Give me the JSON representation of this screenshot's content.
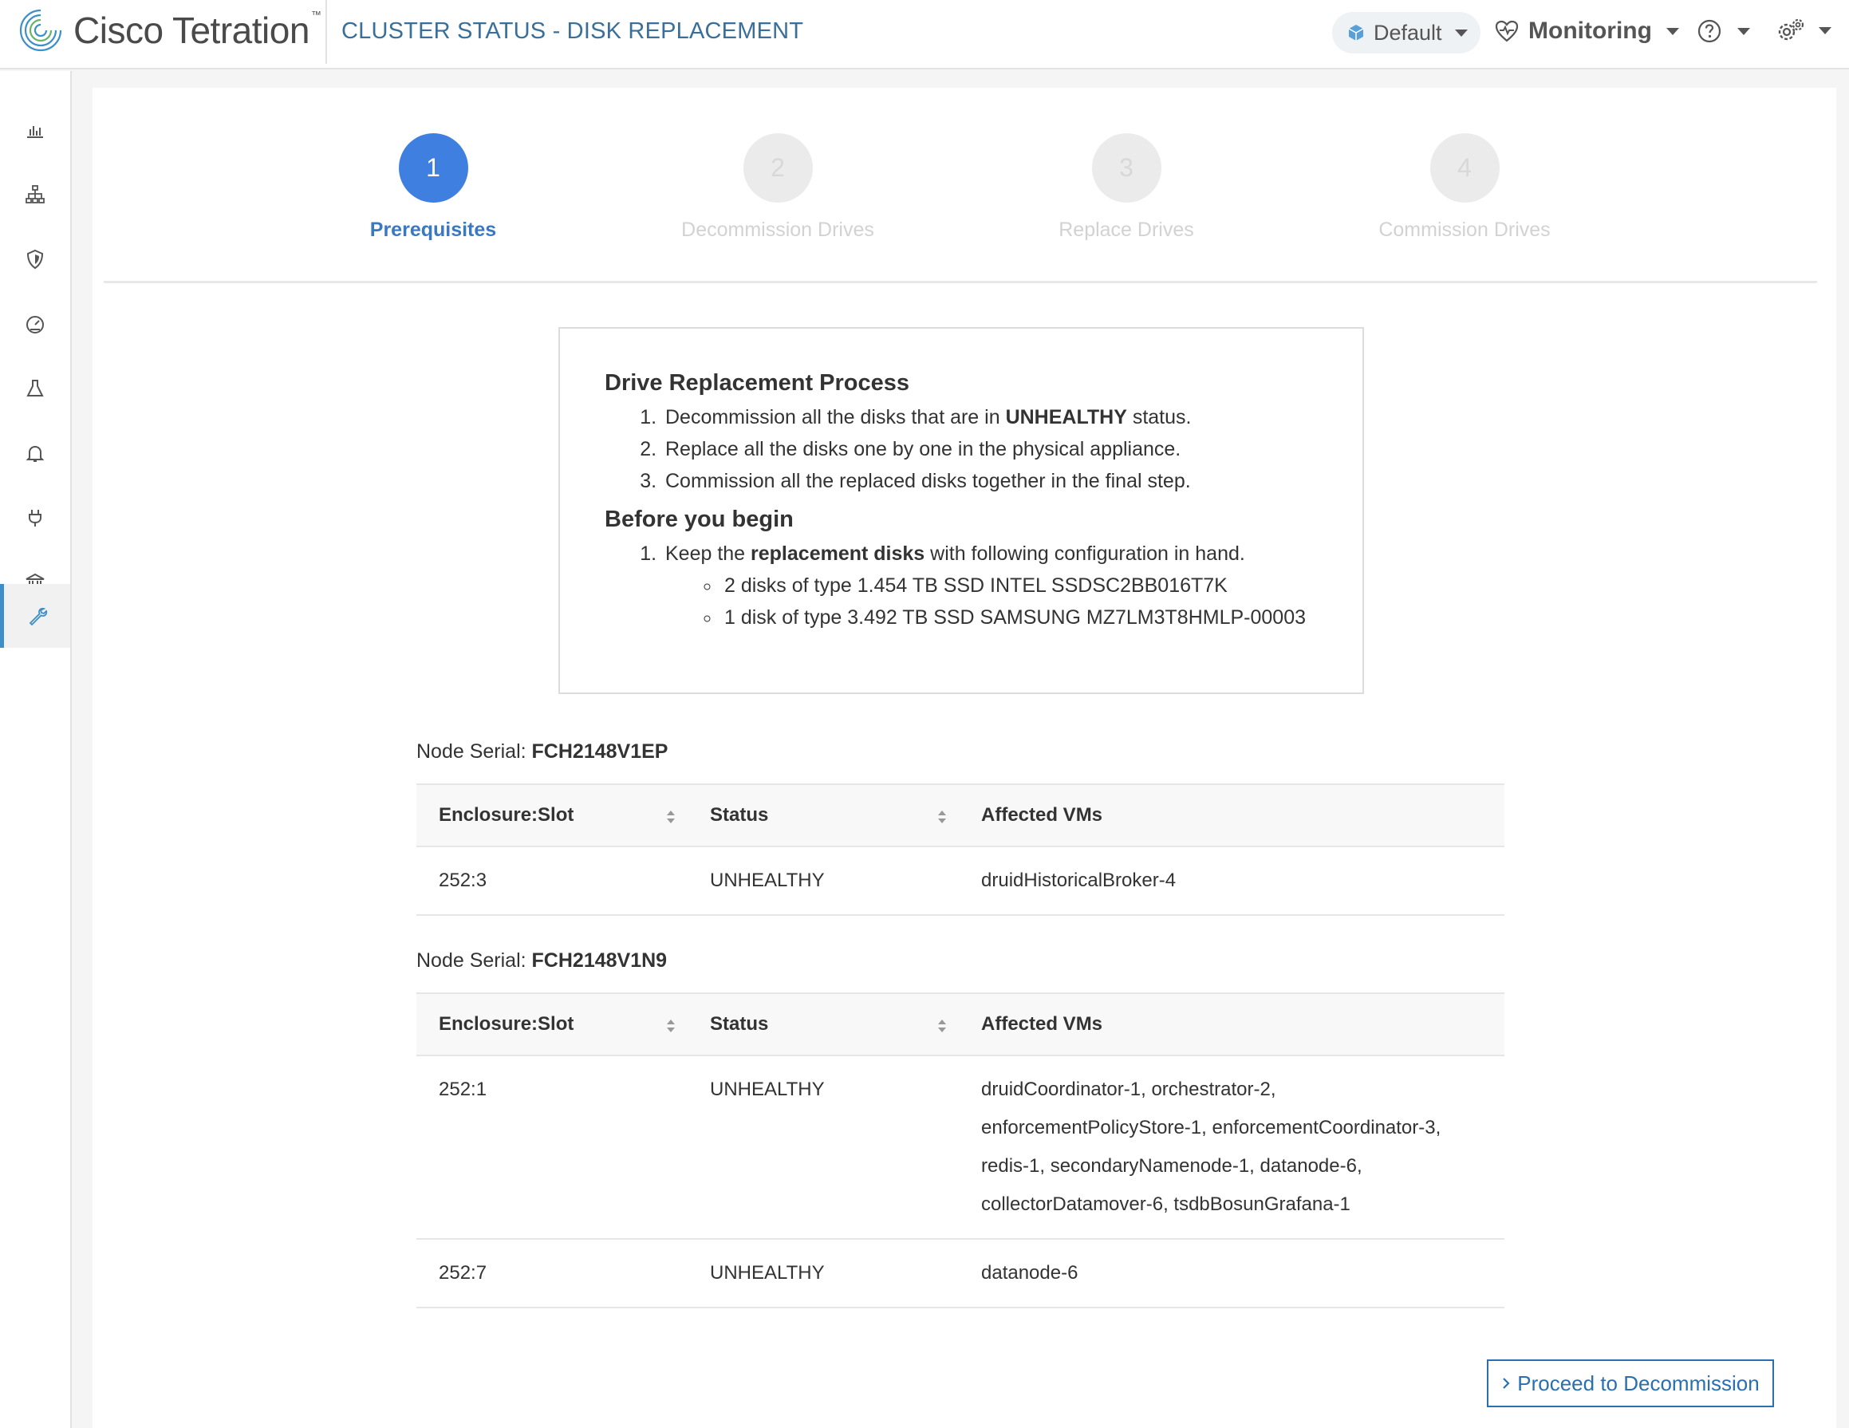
{
  "header": {
    "brand": "Cisco Tetration",
    "brand_tm": "™",
    "page_title": "CLUSTER STATUS - DISK REPLACEMENT",
    "scope": "Default",
    "monitoring": "Monitoring"
  },
  "sidebar": {
    "items": [
      {
        "icon": "bar-chart-icon"
      },
      {
        "icon": "hierarchy-icon"
      },
      {
        "icon": "shield-icon"
      },
      {
        "icon": "speedometer-icon"
      },
      {
        "icon": "flask-icon"
      },
      {
        "icon": "bell-icon"
      },
      {
        "icon": "plug-icon"
      },
      {
        "icon": "bank-icon"
      },
      {
        "icon": "wrench-icon",
        "active": true
      }
    ]
  },
  "stepper": {
    "steps": [
      {
        "number": "1",
        "label": "Prerequisites",
        "active": true
      },
      {
        "number": "2",
        "label": "Decommission Drives",
        "active": false
      },
      {
        "number": "3",
        "label": "Replace Drives",
        "active": false
      },
      {
        "number": "4",
        "label": "Commission Drives",
        "active": false
      }
    ]
  },
  "info": {
    "process_title": "Drive Replacement Process",
    "step1_before": "Decommission all the disks that are in ",
    "step1_bold": "UNHEALTHY",
    "step1_after": " status.",
    "step2": "Replace all the disks one by one in the physical appliance.",
    "step3": "Commission all the replaced disks together in the final step.",
    "begin_title": "Before you begin",
    "begin1_before": "Keep the ",
    "begin1_bold": "replacement disks",
    "begin1_after": " with following configuration in hand.",
    "disk_a": "2 disks of type 1.454 TB SSD INTEL SSDSC2BB016T7K",
    "disk_b": "1 disk of type 3.492 TB SSD SAMSUNG MZ7LM3T8HMLP-00003"
  },
  "nodes": [
    {
      "serial_label": "Node Serial: ",
      "serial": "FCH2148V1EP",
      "rows": [
        {
          "slot": "252:3",
          "status": "UNHEALTHY",
          "vms": [
            "druidHistoricalBroker-4"
          ]
        }
      ]
    },
    {
      "serial_label": "Node Serial: ",
      "serial": "FCH2148V1N9",
      "rows": [
        {
          "slot": "252:1",
          "status": "UNHEALTHY",
          "vms": [
            "druidCoordinator-1, orchestrator-2,",
            "enforcementPolicyStore-1, enforcementCoordinator-3,",
            "redis-1, secondaryNamenode-1, datanode-6,",
            "collectorDatamover-6, tsdbBosunGrafana-1"
          ]
        },
        {
          "slot": "252:7",
          "status": "UNHEALTHY",
          "vms": [
            "datanode-6"
          ]
        }
      ]
    }
  ],
  "table_headers": {
    "slot": "Enclosure:Slot",
    "status": "Status",
    "vms": "Affected VMs"
  },
  "actions": {
    "proceed": "Proceed to Decommission"
  }
}
